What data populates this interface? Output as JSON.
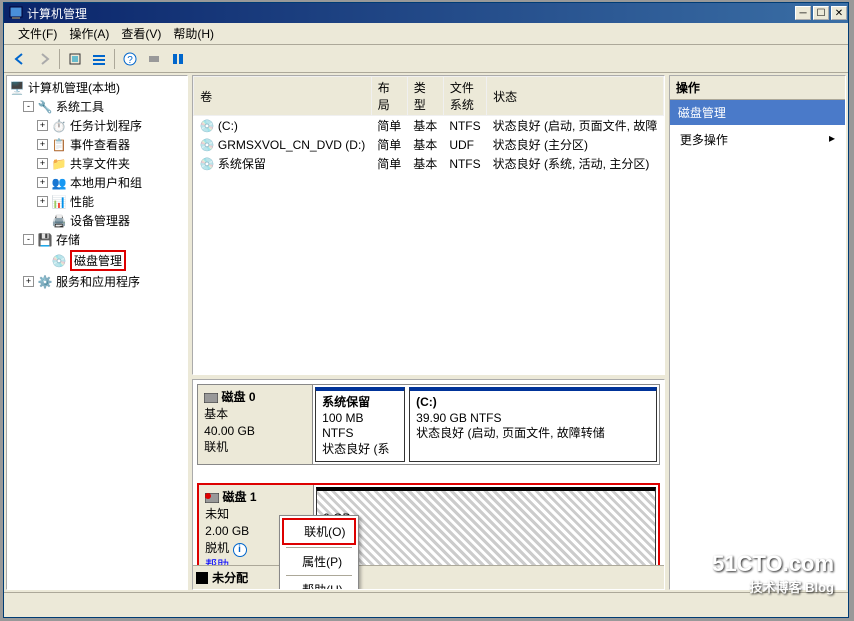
{
  "window": {
    "title": "计算机管理"
  },
  "menu": {
    "file": "文件(F)",
    "action": "操作(A)",
    "view": "查看(V)",
    "help": "帮助(H)"
  },
  "tree": {
    "root": "计算机管理(本地)",
    "system_tools": "系统工具",
    "task_scheduler": "任务计划程序",
    "event_viewer": "事件查看器",
    "shared_folders": "共享文件夹",
    "local_users": "本地用户和组",
    "performance": "性能",
    "device_manager": "设备管理器",
    "storage": "存储",
    "disk_mgmt": "磁盘管理",
    "services_apps": "服务和应用程序"
  },
  "vol_headers": {
    "volume": "卷",
    "layout": "布局",
    "type": "类型",
    "fs": "文件系统",
    "status": "状态"
  },
  "volumes": [
    {
      "name": "(C:)",
      "layout": "简单",
      "type": "基本",
      "fs": "NTFS",
      "status": "状态良好 (启动, 页面文件, 故障"
    },
    {
      "name": "GRMSXVOL_CN_DVD (D:)",
      "layout": "简单",
      "type": "基本",
      "fs": "UDF",
      "status": "状态良好 (主分区)"
    },
    {
      "name": "系统保留",
      "layout": "简单",
      "type": "基本",
      "fs": "NTFS",
      "status": "状态良好 (系统, 活动, 主分区)"
    }
  ],
  "disk0": {
    "title": "磁盘 0",
    "type": "基本",
    "size": "40.00 GB",
    "status": "联机",
    "part1_name": "系统保留",
    "part1_size": "100 MB NTFS",
    "part1_status": "状态良好 (系",
    "part2_name": "(C:)",
    "part2_size": "39.90 GB NTFS",
    "part2_status": "状态良好 (启动, 页面文件, 故障转储"
  },
  "disk1": {
    "title": "磁盘 1",
    "type": "未知",
    "size": "2.00 GB",
    "status": "脱机",
    "help": "帮助",
    "part_size": "0 GB",
    "part_status": "配"
  },
  "context": {
    "online": "联机(O)",
    "properties": "属性(P)",
    "help": "帮助(H)"
  },
  "legend": {
    "unalloc": "未分配"
  },
  "actions": {
    "header": "操作",
    "disk_mgmt": "磁盘管理",
    "more": "更多操作"
  },
  "watermark": {
    "main": "51CTO.com",
    "sub": "技术博客  Blog"
  }
}
